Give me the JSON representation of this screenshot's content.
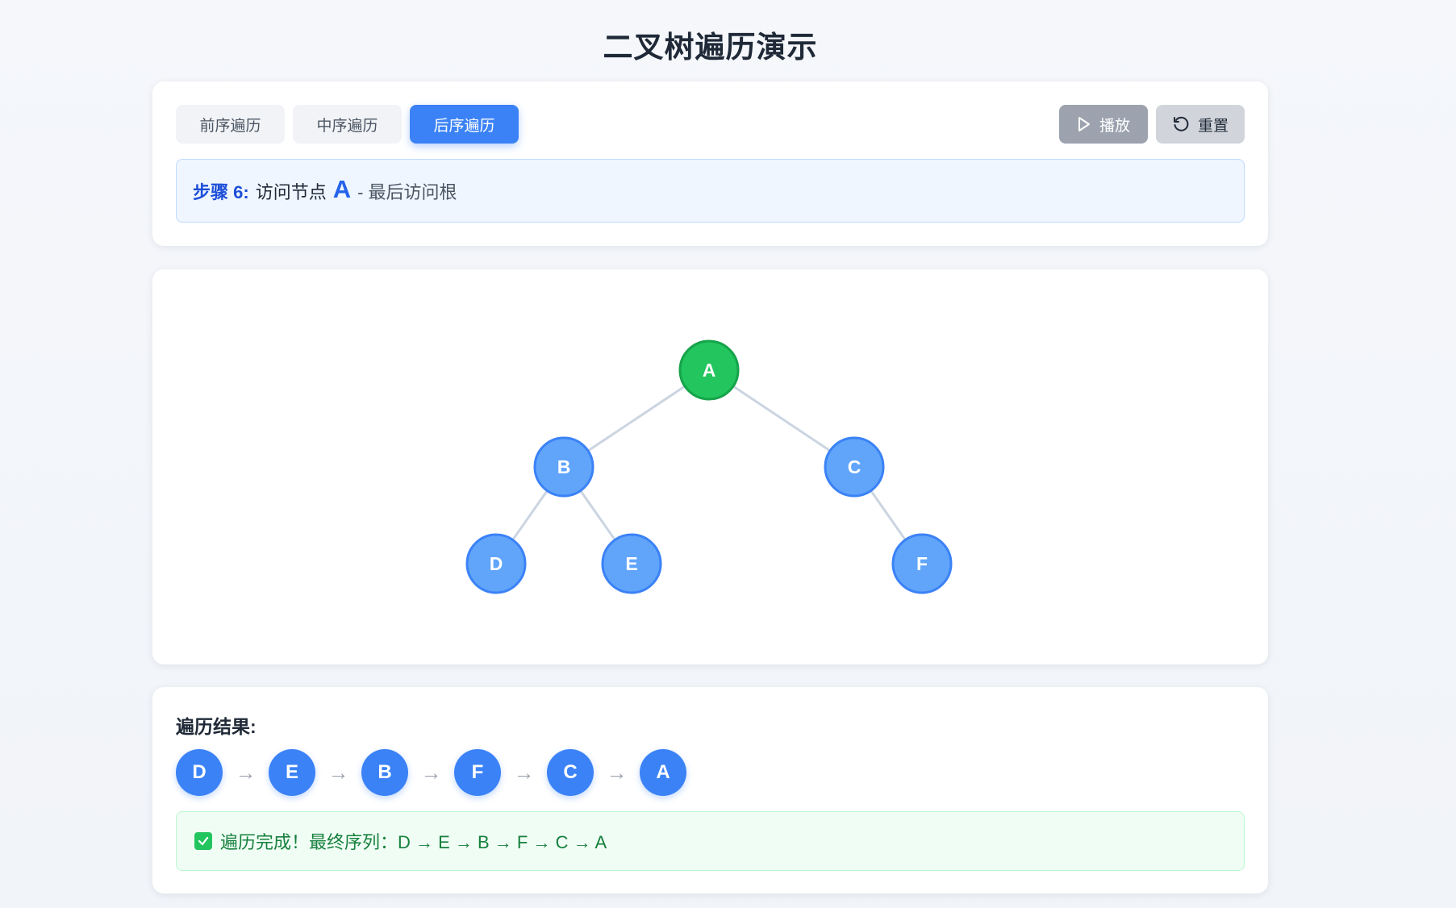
{
  "page": {
    "title": "二叉树遍历演示"
  },
  "tabs": [
    {
      "label": "前序遍历",
      "active": false
    },
    {
      "label": "中序遍历",
      "active": false
    },
    {
      "label": "后序遍历",
      "active": true
    }
  ],
  "actions": {
    "play_label": "播放",
    "reset_label": "重置"
  },
  "step": {
    "label": "步骤 6:",
    "text": "访问节点",
    "node": "A",
    "desc": "- 最后访问根"
  },
  "tree": {
    "nodes": [
      {
        "id": "A",
        "label": "A",
        "state": "visiting"
      },
      {
        "id": "B",
        "label": "B",
        "state": "default"
      },
      {
        "id": "C",
        "label": "C",
        "state": "default"
      },
      {
        "id": "D",
        "label": "D",
        "state": "default"
      },
      {
        "id": "E",
        "label": "E",
        "state": "default"
      },
      {
        "id": "F",
        "label": "F",
        "state": "default"
      }
    ],
    "edges": [
      [
        "A",
        "B"
      ],
      [
        "A",
        "C"
      ],
      [
        "B",
        "D"
      ],
      [
        "B",
        "E"
      ],
      [
        "C",
        "F"
      ]
    ],
    "colors": {
      "default": "#60a5fa",
      "default_border": "#3b82f6",
      "visiting": "#22c55e",
      "visiting_border": "#16a34a",
      "edge": "#cbd5e1"
    }
  },
  "result": {
    "heading": "遍历结果:",
    "sequence": [
      "D",
      "E",
      "B",
      "F",
      "C",
      "A"
    ],
    "arrow": "→",
    "done_text": "遍历完成！最终序列：D → E → B → F → C → A"
  }
}
